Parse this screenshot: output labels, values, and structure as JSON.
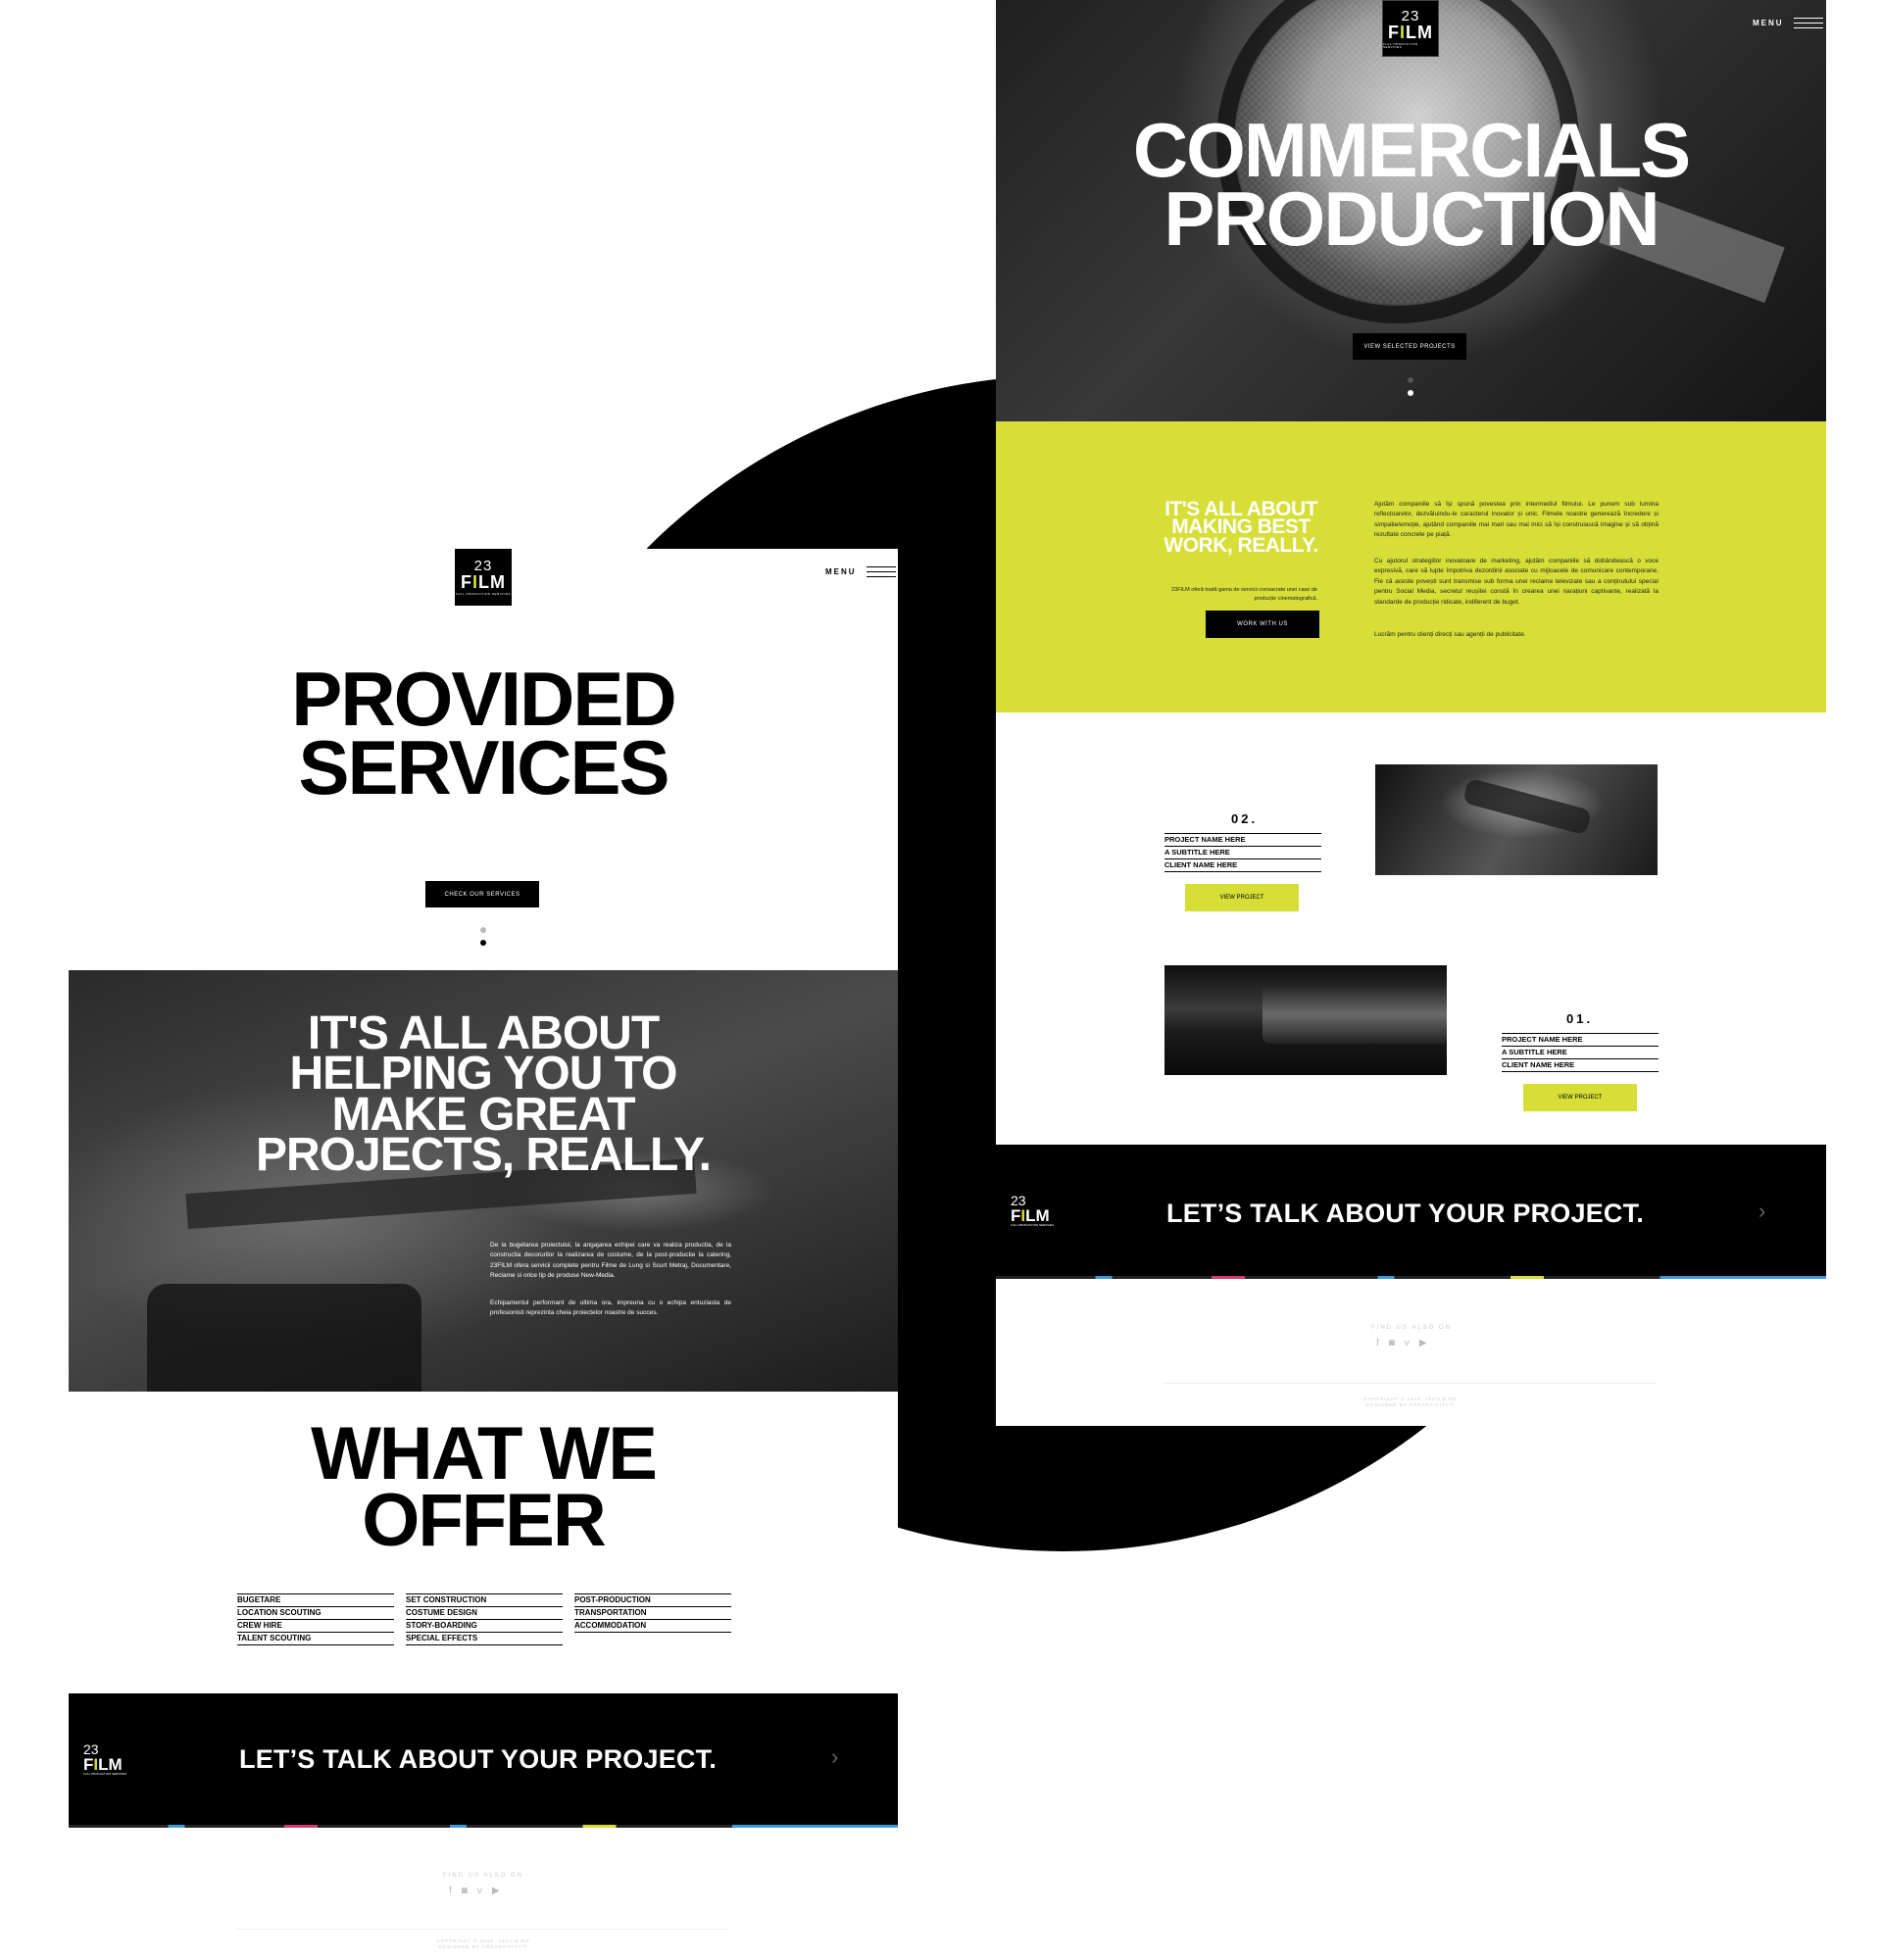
{
  "brand": {
    "logo_num": "23",
    "logo_film": "FILM",
    "logo_tagline": "FULL PRODUCTION SERVICES",
    "lime": "#d6de37"
  },
  "left_page": {
    "menu_label": "MENU",
    "hero_title": "PROVIDED\nSERVICES",
    "hero_button": "CHECK OUR SERVICES",
    "slide_count": 2,
    "active_slide": 2,
    "about_title": "IT'S ALL ABOUT\nHELPING YOU TO\nMAKE GREAT\nPROJECTS, REALLY.",
    "about_p1": "De la bugetarea proiectului, la angajarea echipei care va realiza productia, de la constructia decorurilor la realizarea de costume, de la post-productie la catering, 23FILM ofera servicii complete pentru Filme de Lung si Scurt Metraj, Documentare, Reclame si orice tip de produse New-Media.",
    "about_p2": "Echipamentul performant de ultima ora, impreuna cu o echipa entuziasta de profesionisti reprezinta cheia proiectelor noastre de succes.",
    "offer_title": "WHAT WE\nOFFER",
    "offer_columns": [
      [
        "BUGETARE",
        "LOCATION SCOUTING",
        "CREW HIRE",
        "TALENT SCOUTING"
      ],
      [
        "SET CONSTRUCTION",
        "COSTUME DESIGN",
        "STORY-BOARDING",
        "SPECIAL EFFECTS"
      ],
      [
        "POST-PRODUCTION",
        "TRANSPORTATION",
        "ACCOMMODATION"
      ]
    ],
    "cta_text": "LET’S TALK ABOUT YOUR PROJECT.",
    "footer_find": "FIND US ALSO ON",
    "footer_copy_1": "COPYRIGHT © 2016. 23FILM.RO",
    "footer_copy_2": "DESIGNED BY CREANTIVITY™"
  },
  "right_page": {
    "menu_label": "MENU",
    "hero_title": "COMMERCIALS\nPRODUCTION",
    "hero_button": "VIEW SELECTED PROJECTS",
    "slide_count": 2,
    "active_slide": 2,
    "lime_title": "IT'S ALL ABOUT\nMAKING BEST\nWORK, REALLY.",
    "lime_intro": "23FILM oferă toată gama de servicii consacrate unei case de producție cinematografică.",
    "lime_button": "WORK WITH US",
    "lime_p1": "Ajutăm companiile să își spună povestea prin intermediul filmului. Le punem sub lumina reflectoarelor, dezvăluindu-le caracterul inovator și unic. Filmele noastre generează încredere și simpatie/emoție, ajutând companiile mai mari sau mai mici să își construiască imagine și să obțină rezultate concrete pe piață.",
    "lime_p2": "Cu ajutorul strategiilor inovatoare de marketing, ajutăm companiile să dobândească o voce expresivă, care să lupte împotriva dezordinii asociate cu mijloacele de comunicare contemporane. Fie că aceste povești sunt transmise sub forma unei reclame televizate sau a conținutului special pentru Social Media, secretul reușitei constă în crearea unei narațiuni captivante, realizată la standarde de producție ridicate, indiferent de buget.",
    "lime_p3": "Lucrăm pentru clienți direcți sau agenții de publicitate.",
    "projects": [
      {
        "num": "02.",
        "name": "PROJECT NAME HERE",
        "subtitle": "A SUBTITLE HERE",
        "client": "CLIENT NAME HERE",
        "button": "VIEW PROJECT"
      },
      {
        "num": "01.",
        "name": "PROJECT NAME HERE",
        "subtitle": "A SUBTITLE HERE",
        "client": "CLIENT NAME HERE",
        "button": "VIEW PROJECT"
      }
    ],
    "cta_text": "LET’S TALK ABOUT YOUR PROJECT.",
    "footer_find": "FIND US ALSO ON",
    "footer_copy_1": "COPYRIGHT © 2016. 23FILM.RO",
    "footer_copy_2": "DESIGNED BY CREANTIVITY™"
  },
  "socials": {
    "facebook_glyph": "f",
    "instagram_glyph": "◙",
    "vimeo_glyph": "v",
    "youtube_glyph": "▶"
  }
}
